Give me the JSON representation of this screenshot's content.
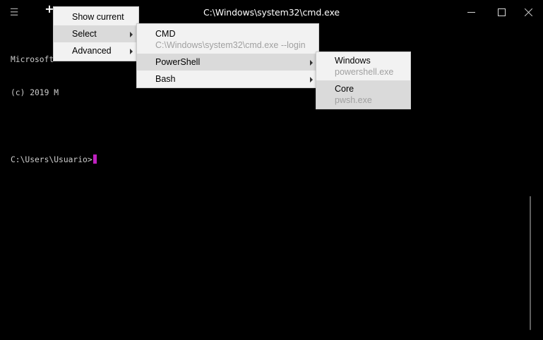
{
  "titlebar": {
    "title": "C:\\Windows\\system32\\cmd.exe",
    "menu_icon": "hamburger-icon",
    "new_tab_icon": "plus-icon",
    "minimize_icon": "minimize-icon",
    "maximize_icon": "maximize-icon",
    "close_icon": "close-icon"
  },
  "console": {
    "line1": "Microsoft",
    "line2": "(c) 2019 M",
    "prompt": "C:\\Users\\Usuario>",
    "cursor_color": "#c020c0"
  },
  "menu": {
    "items": [
      {
        "label": "Show current"
      },
      {
        "label": "Select"
      },
      {
        "label": "Advanced"
      }
    ]
  },
  "select_menu": {
    "cmd": {
      "label": "CMD",
      "detail": "C:\\Windows\\system32\\cmd.exe --login"
    },
    "powershell": {
      "label": "PowerShell"
    },
    "bash": {
      "label": "Bash"
    }
  },
  "powershell_menu": {
    "windows": {
      "label": "Windows",
      "detail": "powershell.exe"
    },
    "core": {
      "label": "Core",
      "detail": "pwsh.exe"
    }
  }
}
